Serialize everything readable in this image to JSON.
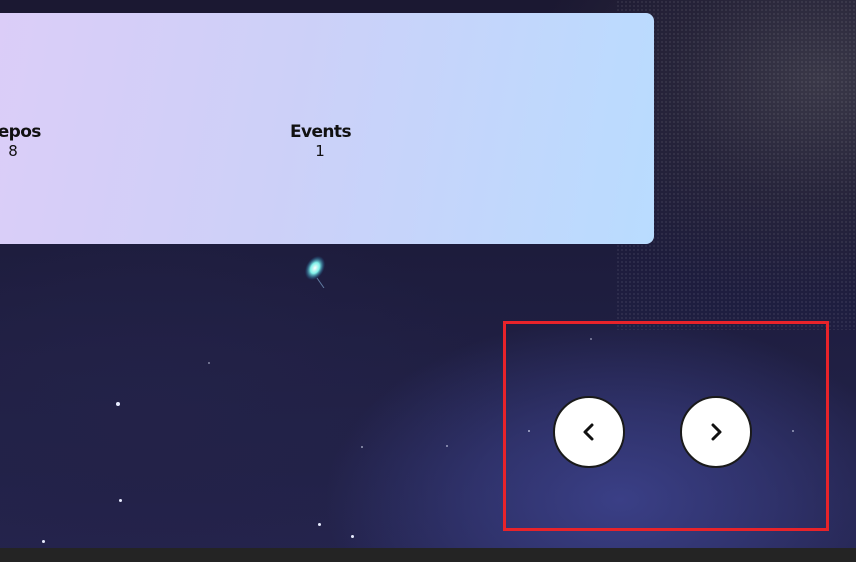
{
  "stats": [
    {
      "label": "Repos",
      "value": "8"
    },
    {
      "label": "Events",
      "value": "1"
    }
  ],
  "carousel": {
    "prev_icon": "chevron-left-icon",
    "next_icon": "chevron-right-icon"
  },
  "colors": {
    "highlight": "#e8232a",
    "card_gradient_start": "#dccdf8",
    "card_gradient_end": "#b9dcff",
    "button_bg": "#ffffff"
  }
}
